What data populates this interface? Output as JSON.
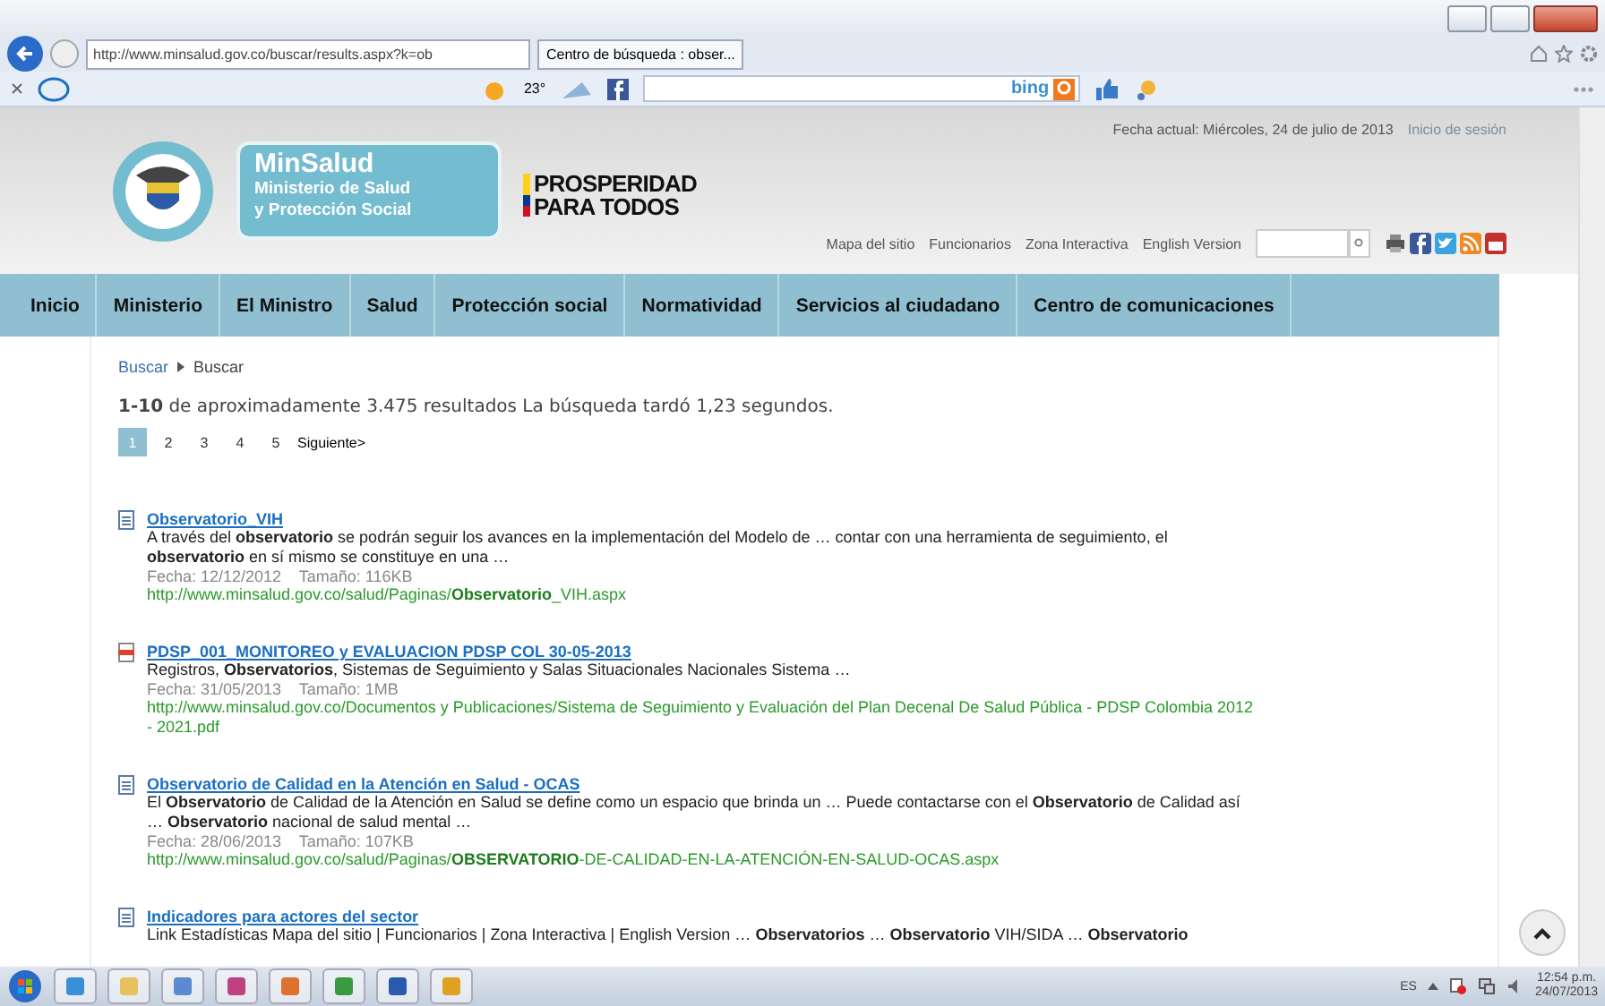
{
  "browser": {
    "address": "http://www.minsalud.gov.co/buscar/results.aspx?k=ob",
    "tab": {
      "label": "Centro de búsqueda : obser...",
      "selected": true
    },
    "weather": "23°",
    "bing": "bing"
  },
  "header": {
    "date": "Fecha actual: Miércoles, 24 de julio de 2013",
    "login": "Inicio de sesión",
    "brand": "MinSalud",
    "brand_lines": [
      "Ministerio de Salud",
      "y Protección Social"
    ],
    "slogan": [
      "PROSPERIDAD",
      "PARA TODOS"
    ],
    "links": [
      "Mapa del sitio",
      "Funcionarios",
      "Zona Interactiva",
      "English Version"
    ]
  },
  "nav": [
    "Inicio",
    "Ministerio",
    "El Ministro",
    "Salud",
    "Protección social",
    "Normatividad",
    "Servicios al ciudadano",
    "Centro de comunicaciones"
  ],
  "breadcrumb": [
    "Buscar",
    "Buscar"
  ],
  "summary": "**1-10** de aproximadamente 3.475 resultados La búsqueda tardó 1,23 segundos.",
  "pages": [
    {
      "label": "1",
      "selected": true
    },
    {
      "label": "2",
      "selected": false
    },
    {
      "label": "3",
      "selected": false
    },
    {
      "label": "4",
      "selected": false
    },
    {
      "label": "5",
      "selected": false
    }
  ],
  "next": "Siguiente>",
  "results": [
    {
      "kind": "page",
      "title": "Observatorio_VIH",
      "snippet": "A través del **observatorio** se podrán seguir los avances en la implementación del Modelo de … contar con una herramienta de seguimiento, el **observatorio** en sí mismo se constituye en una …",
      "meta": "Fecha: 12/12/2012    Tamaño: 116KB",
      "url": "http://www.minsalud.gov.co/salud/Paginas/**Observatorio**_VIH.aspx"
    },
    {
      "kind": "pdf",
      "title": "PDSP_001_MONITOREO y EVALUACION PDSP COL 30-05-2013",
      "snippet": "Registros, **Observatorios**, Sistemas de Seguimiento y Salas Situacionales Nacionales Sistema …",
      "meta": "Fecha: 31/05/2013    Tamaño: 1MB",
      "url": "http://www.minsalud.gov.co/Documentos y Publicaciones/Sistema de Seguimiento y Evaluación del Plan Decenal De Salud Pública - PDSP Colombia 2012 - 2021.pdf"
    },
    {
      "kind": "page",
      "title": "Observatorio de Calidad en la Atención en Salud - OCAS",
      "snippet": "El **Observatorio** de Calidad de la Atención en Salud se define como un espacio que brinda un … Puede contactarse con el **Observatorio** de Calidad así … **Observatorio** nacional de salud mental …",
      "meta": "Fecha: 28/06/2013    Tamaño: 107KB",
      "url": "http://www.minsalud.gov.co/salud/Paginas/**OBSERVATORIO**-DE-CALIDAD-EN-LA-ATENCIÓN-EN-SALUD-OCAS.aspx"
    },
    {
      "kind": "page",
      "title": "Indicadores para actores del sector",
      "snippet": "Link Estadísticas Mapa del sitio | Funcionarios | Zona Interactiva | English Version … **Observatorios** … **Observatorio** VIH/SIDA … **Observatorio**"
    }
  ],
  "taskbar": {
    "language": "ES",
    "time": "12:54 p.m.",
    "date": "24/07/2013"
  }
}
